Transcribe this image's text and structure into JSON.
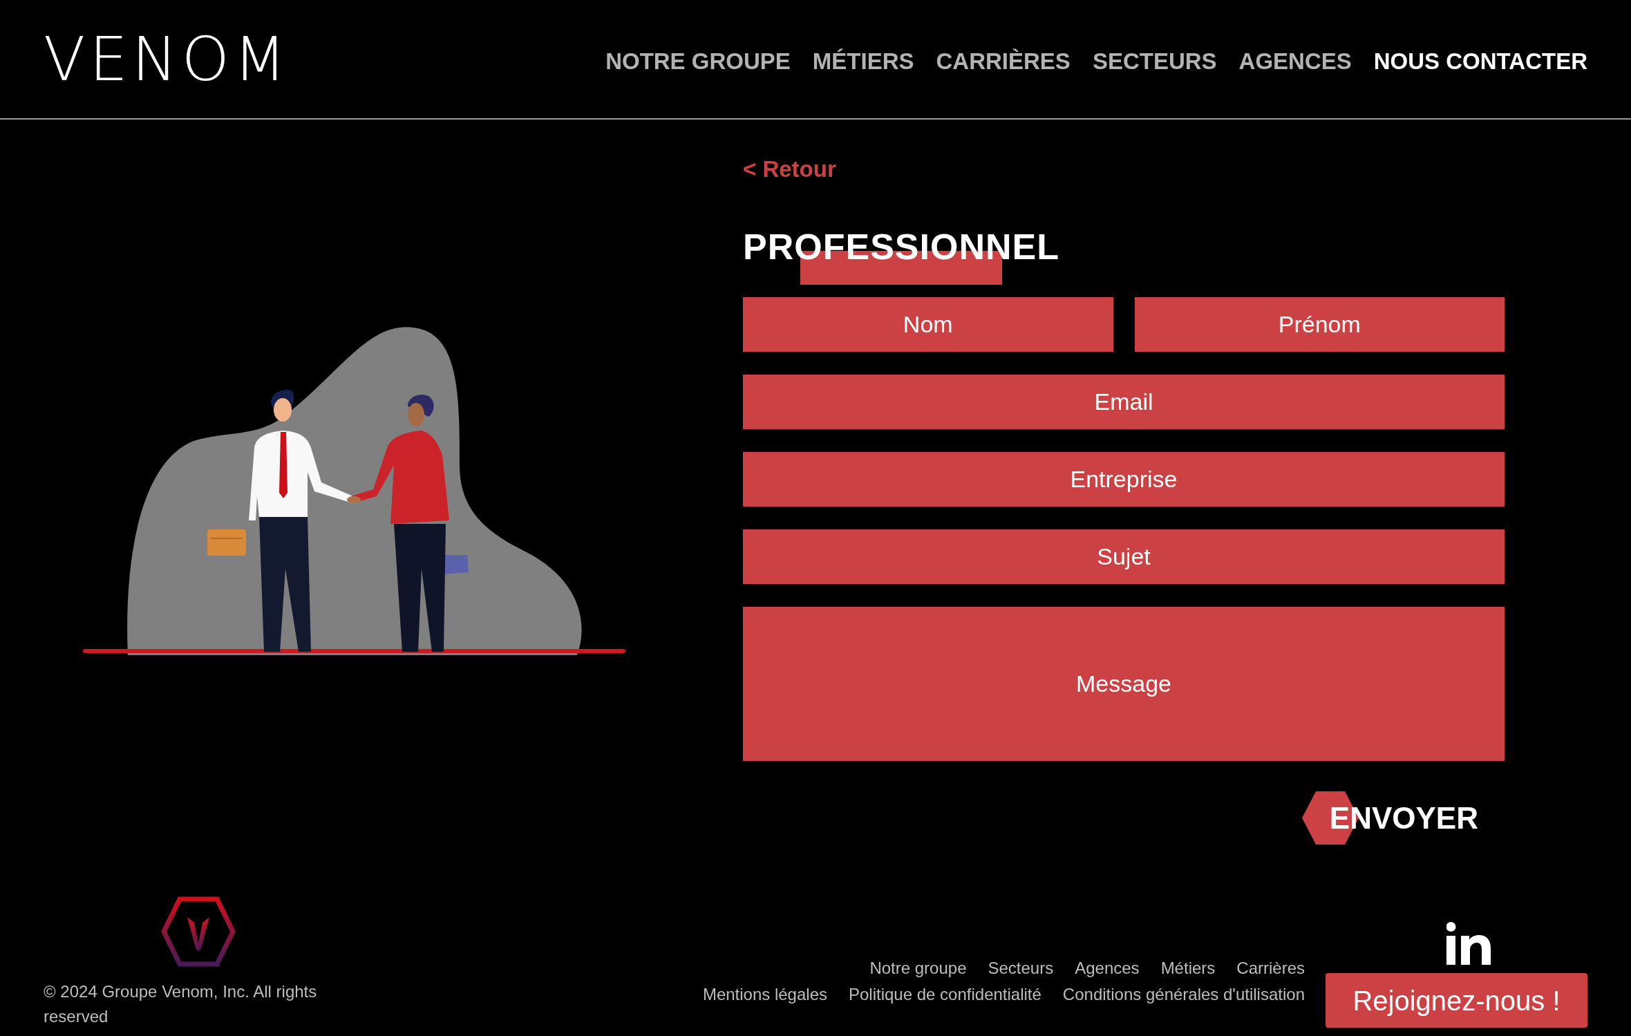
{
  "header": {
    "logo": "VENOM",
    "nav": [
      {
        "label": "NOTRE GROUPE",
        "selected": false
      },
      {
        "label": "MÉTIERS",
        "selected": false
      },
      {
        "label": "CARRIÈRES",
        "selected": false
      },
      {
        "label": "SECTEURS",
        "selected": false
      },
      {
        "label": "AGENCES",
        "selected": false
      },
      {
        "label": "NOUS CONTACTER",
        "selected": true
      }
    ]
  },
  "form": {
    "back_link": "< Retour",
    "title": "PROFESSIONNEL",
    "fields": [
      {
        "placeholder": "Nom",
        "kind": "half"
      },
      {
        "placeholder": "Prénom",
        "kind": "half"
      },
      {
        "placeholder": "Email",
        "kind": "full"
      },
      {
        "placeholder": "Entreprise",
        "kind": "full"
      },
      {
        "placeholder": "Sujet",
        "kind": "full"
      },
      {
        "placeholder": "Message",
        "kind": "textarea"
      }
    ],
    "submit": "ENVOYER"
  },
  "footer": {
    "copyright": "© 2024 Groupe Venom, Inc. All rights reserved",
    "links_row_1": [
      "Notre groupe",
      "Secteurs",
      "Agences",
      "Métiers",
      "Carrières"
    ],
    "links_row_2": [
      "Mentions légales",
      "Politique de confidentialité",
      "Conditions générales d'utilisation"
    ],
    "join_button": "Rejoignez-nous !"
  }
}
